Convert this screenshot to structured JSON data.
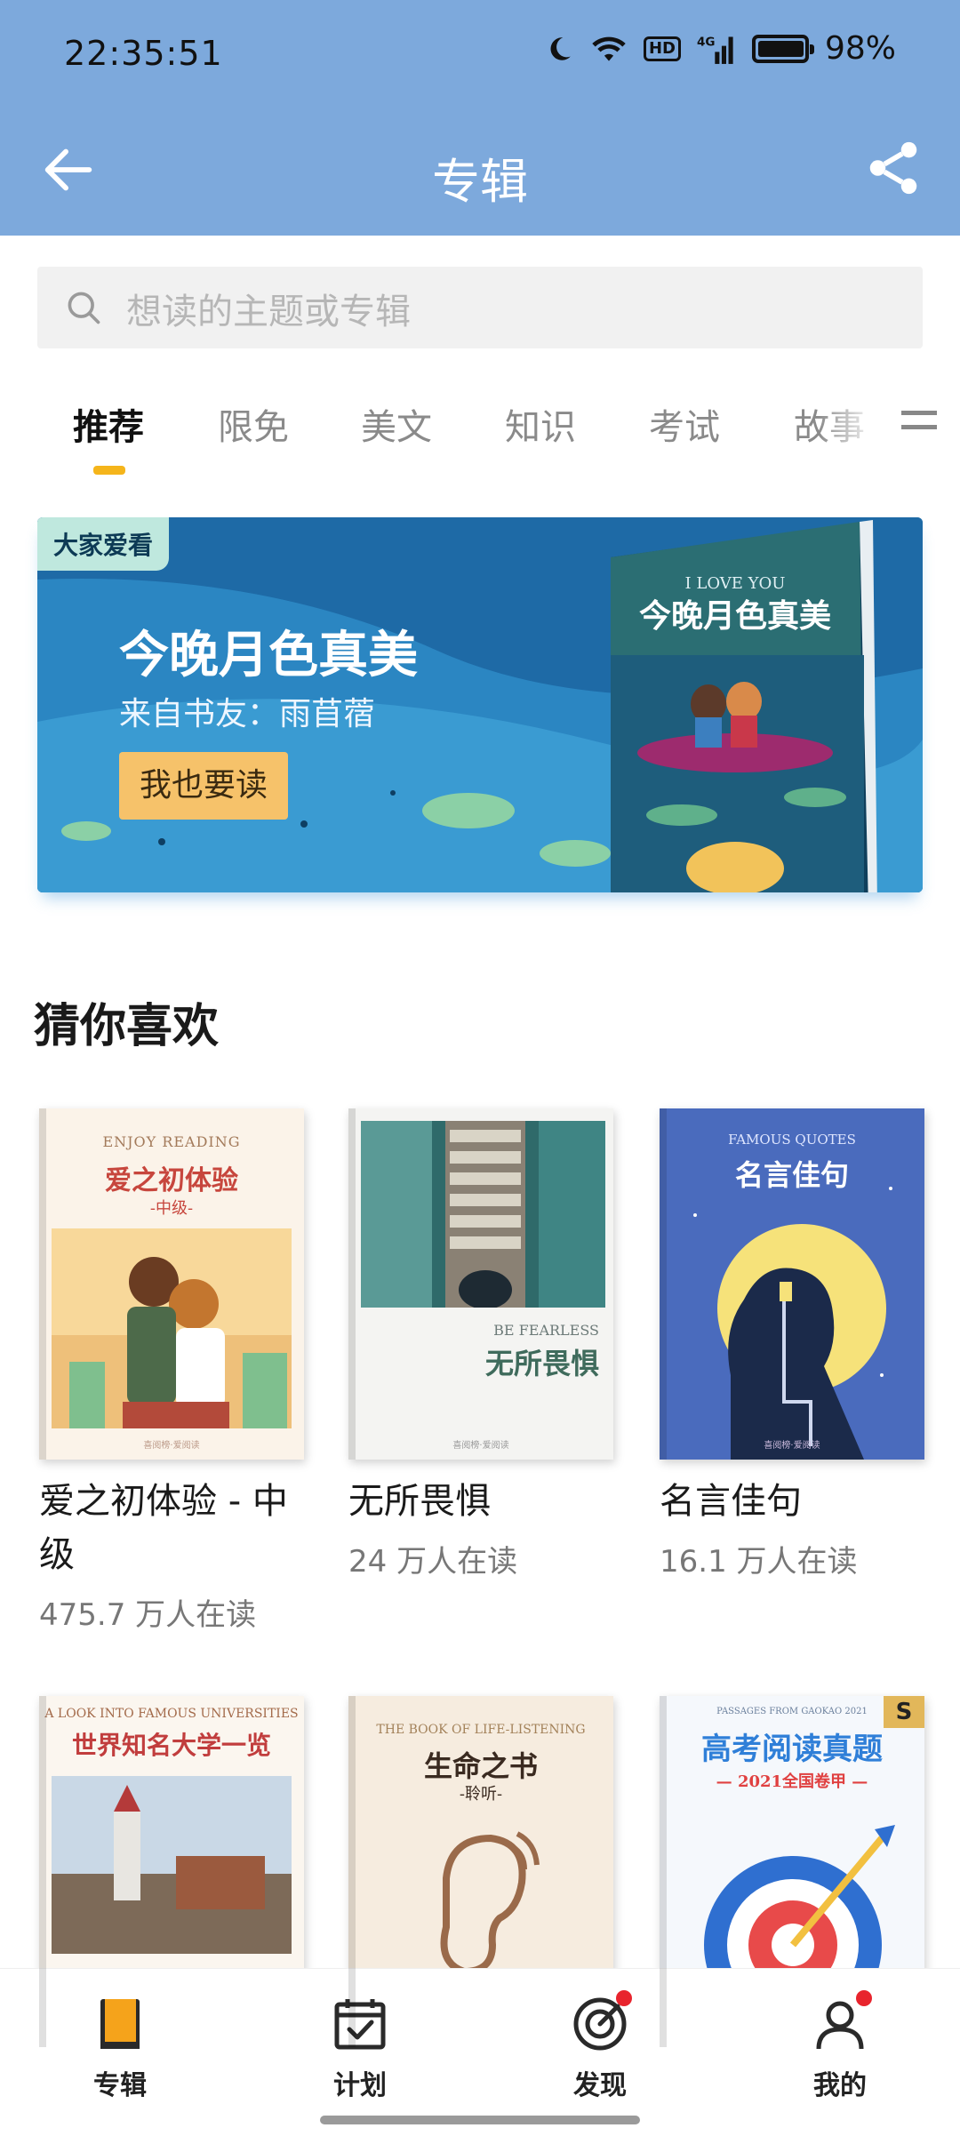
{
  "status_bar": {
    "time": "22:35:51",
    "network": "4G",
    "hd_label": "HD",
    "battery": "98%",
    "battery_level": 0.98
  },
  "header": {
    "title": "专辑"
  },
  "search": {
    "placeholder": "想读的主题或专辑"
  },
  "tabs": [
    {
      "label": "推荐",
      "active": true
    },
    {
      "label": "限免"
    },
    {
      "label": "美文"
    },
    {
      "label": "知识"
    },
    {
      "label": "考试"
    },
    {
      "label": "故事"
    }
  ],
  "banner": {
    "tag": "大家爱看",
    "title": "今晚月色真美",
    "subtitle": "来自书友：雨苜蓿",
    "button": "我也要读",
    "cover_en": "I LOVE YOU",
    "cover_zh": "今晚月色真美"
  },
  "section": {
    "title": "猜你喜欢"
  },
  "books": [
    {
      "name": "爱之初体验 - 中级",
      "readers": "475.7 万人在读",
      "cover_en": "ENJOY READING",
      "cover_zh": "爱之初体验",
      "cover_sub": "-中级-",
      "badge": "喜阅榜·爱阅读"
    },
    {
      "name": "无所畏惧",
      "readers": "24 万人在读",
      "cover_en": "BE FEARLESS",
      "cover_zh": "无所畏惧",
      "badge": "喜阅榜·爱阅读"
    },
    {
      "name": "名言佳句",
      "readers": "16.1 万人在读",
      "cover_en": "FAMOUS QUOTES",
      "cover_zh": "名言佳句",
      "badge": "喜阅榜·爱阅读"
    },
    {
      "cover_en": "A LOOK INTO FAMOUS UNIVERSITIES",
      "cover_zh": "世界知名大学一览"
    },
    {
      "cover_en": "THE BOOK OF LIFE-LISTENING",
      "cover_zh": "生命之书",
      "cover_sub": "-聆听-"
    },
    {
      "cover_en": "PASSAGES FROM GAOKAO 2021",
      "cover_zh": "高考阅读真题",
      "cover_sub": "— 2021全国卷甲 —",
      "badge": "S"
    }
  ],
  "bottom_nav": [
    {
      "label": "专辑",
      "icon": "book-icon",
      "active": true
    },
    {
      "label": "计划",
      "icon": "calendar-check-icon"
    },
    {
      "label": "发现",
      "icon": "target-icon",
      "dot": true
    },
    {
      "label": "我的",
      "icon": "user-icon",
      "dot": true
    }
  ],
  "colors": {
    "header": "#7da9dc",
    "accent": "#f5b51b",
    "banner": "#2a7db8"
  }
}
